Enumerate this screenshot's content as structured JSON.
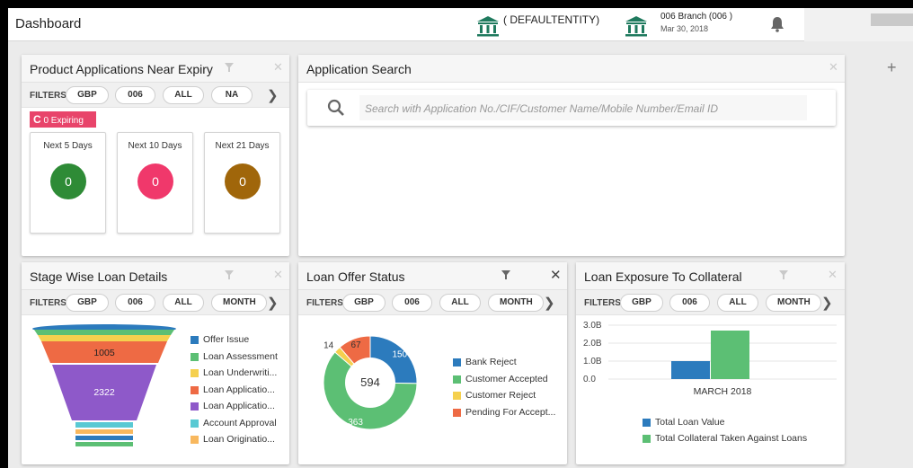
{
  "header": {
    "title": "Dashboard",
    "entity": "( DEFAULTENTITY)",
    "branch": "006 Branch  (006 )",
    "date": "Mar 30, 2018"
  },
  "add_widget_label": "+",
  "filters_label": "FILTERS",
  "expiry": {
    "title": "Product Applications Near Expiry",
    "filters": [
      "GBP",
      "006",
      "ALL",
      "NA"
    ],
    "expiring_label": "0 Expiring",
    "cards": [
      {
        "label": "Next 5 Days",
        "value": "0",
        "color": "#2e8b36"
      },
      {
        "label": "Next 10 Days",
        "value": "0",
        "color": "#f0386b"
      },
      {
        "label": "Next 21 Days",
        "value": "0",
        "color": "#a0660a"
      }
    ]
  },
  "search": {
    "title": "Application Search",
    "placeholder": "Search with Application No./CIF/Customer Name/Mobile Number/Email ID"
  },
  "stage": {
    "title": "Stage Wise Loan Details",
    "filters": [
      "GBP",
      "006",
      "ALL",
      "MONTH"
    ],
    "labels": [
      "1005",
      "2322"
    ],
    "legend": [
      {
        "label": "Offer Issue",
        "color": "#2c7bbd"
      },
      {
        "label": "Loan Assessment",
        "color": "#5cbf74"
      },
      {
        "label": "Loan Underwriti...",
        "color": "#f5d04e"
      },
      {
        "label": "Loan Applicatio...",
        "color": "#ee6a44"
      },
      {
        "label": "Loan Applicatio...",
        "color": "#8e59c9"
      },
      {
        "label": "Account Approval",
        "color": "#59c9d3"
      },
      {
        "label": "Loan Originatio...",
        "color": "#f8b85e"
      }
    ]
  },
  "offer": {
    "title": "Loan Offer Status",
    "filters": [
      "GBP",
      "006",
      "ALL",
      "MONTH"
    ],
    "total": "594",
    "chart_data": {
      "type": "pie",
      "categories": [
        "Bank Reject",
        "Customer Accepted",
        "Customer Reject",
        "Pending For Accept..."
      ],
      "values": [
        150,
        363,
        14,
        67
      ],
      "colors": [
        "#2c7bbd",
        "#5cbf74",
        "#f5d04e",
        "#ee6a44"
      ]
    }
  },
  "exposure": {
    "title": "Loan Exposure To Collateral",
    "filters": [
      "GBP",
      "006",
      "ALL",
      "MONTH"
    ],
    "chart_data": {
      "type": "bar",
      "categories": [
        "MARCH 2018"
      ],
      "series": [
        {
          "name": "Total Loan Value",
          "values": [
            1000000000
          ],
          "color": "#2c7bbd"
        },
        {
          "name": "Total Collateral Taken Against Loans",
          "values": [
            2700000000
          ],
          "color": "#5cbf74"
        }
      ],
      "yticks": [
        "3.0B",
        "2.0B",
        "1.0B",
        "0.0"
      ],
      "ylim": [
        0,
        3000000000
      ]
    }
  }
}
